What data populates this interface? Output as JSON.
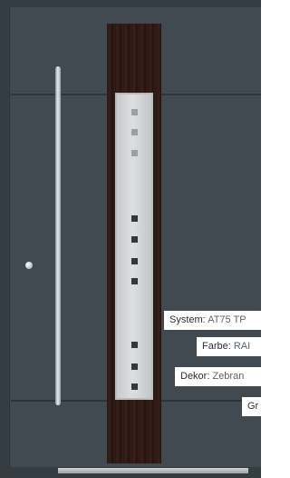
{
  "colors": {
    "frame": "#353c42",
    "leaf": "#414a51",
    "wood_inlay": "#2f1a14",
    "glass": "#d4d8d8",
    "handle": "#c9cdcf",
    "label_background": "#ffffff"
  },
  "specs": [
    {
      "key": "System:",
      "value": "AT75 TP"
    },
    {
      "key": "Farbe:",
      "value": "RAI"
    },
    {
      "key": "Dekor:",
      "value": "Zebran"
    },
    {
      "key": "Gr",
      "value": ""
    }
  ],
  "glass_squares": [
    "light",
    "light",
    "light",
    "dark",
    "dark",
    "dark",
    "dark",
    "dark",
    "dark",
    "dark"
  ]
}
